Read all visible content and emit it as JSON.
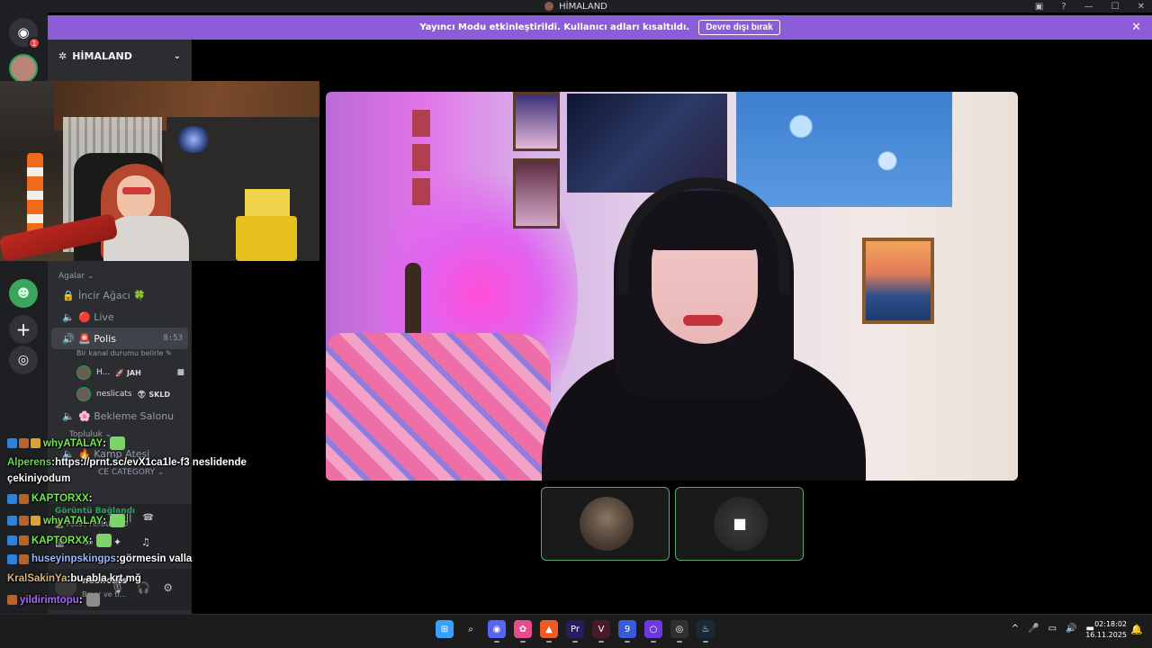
{
  "window": {
    "title": "HİMALAND",
    "controls": [
      "—",
      "☐",
      "✕"
    ]
  },
  "banner": {
    "message": "Yayıncı Modu etkinleştirildi. Kullanıcı adları kısaltıldı.",
    "button": "Devre dışı bırak",
    "close": "✕"
  },
  "rail": {
    "home_badge": "1"
  },
  "server": {
    "name": "HİMALAND"
  },
  "channels": {
    "category": "Agalar ⌄",
    "items": [
      {
        "name": "İncir Ağacı 🍀",
        "icon": "lock-icon"
      },
      {
        "name": "🔴 Live",
        "icon": "speaker-icon"
      },
      {
        "name": "🚨 Polis",
        "icon": "speaker-icon",
        "time": "8:53"
      },
      {
        "name": "🌸 Bekleme Salonu",
        "icon": "speaker-icon"
      }
    ],
    "status_placeholder": "Bir kanal durumu belirle ✎",
    "members": [
      {
        "name": "H...",
        "tag": "🚀 JAH"
      },
      {
        "name": "neslicats",
        "tag": "👽 SKLD"
      }
    ],
    "second_category": "Topluluk ⌄",
    "campfire": "🔥 Kamp Ateşi",
    "third_category": "CE CATEGORY ⌄"
  },
  "voice_panel": {
    "status": "Görüntü Bağlandı",
    "location": "🚨 Polis / HİMALAND"
  },
  "user_panel": {
    "name": "neslicats",
    "sub": "Bmor ve tl..."
  },
  "chat": [
    {
      "user": "whyATALAY",
      "sep": " :",
      "text": "",
      "badges": [
        "prime",
        "gift",
        "crown"
      ],
      "color": "green",
      "emote": "green"
    },
    {
      "user": "Alperens",
      "sep": " :",
      "text": " https://prnt.sc/evX1ca1le-f3 neslidende",
      "badges": [],
      "color": "lime"
    },
    {
      "user": "",
      "sep": "",
      "text": "çekiniyodum",
      "badges": [],
      "color": "white"
    },
    {
      "user": "KAPTORXX",
      "sep": " :",
      "text": "",
      "badges": [
        "prime",
        "gift"
      ],
      "color": "green"
    },
    {
      "user": "whyATALAY",
      "sep": " :",
      "text": "",
      "badges": [
        "prime",
        "gift",
        "crown"
      ],
      "color": "green",
      "emote": "green"
    },
    {
      "user": "KAPTORXX",
      "sep": " :",
      "text": "",
      "badges": [
        "prime",
        "gift"
      ],
      "color": "green",
      "emote": "green"
    },
    {
      "user": "huseyinpskingps",
      "sep": " :",
      "text": " görmesin valla",
      "badges": [
        "prime",
        "gift"
      ],
      "color": "blue"
    },
    {
      "user": "KralSakinYa",
      "sep": " :",
      "text": " bu abla krt mğ",
      "badges": [],
      "color": "tan"
    },
    {
      "user": "yildirimtopu",
      "sep": " :",
      "text": "",
      "badges": [
        "gift"
      ],
      "color": "purple",
      "emote": "gray"
    },
    {
      "user": "KAPTORXX",
      "sep": " :",
      "text": "",
      "badges": [
        "prime",
        "gift"
      ],
      "color": "green",
      "emote": "green"
    }
  ],
  "taskbar": {
    "apps": [
      {
        "name": "start-button",
        "glyph": "⊞",
        "color": "#3aa0ff"
      },
      {
        "name": "search-button",
        "glyph": "⌕",
        "color": "#1c1c1c"
      },
      {
        "name": "discord-app",
        "glyph": "◉",
        "color": "#5865f2"
      },
      {
        "name": "photos-app",
        "glyph": "✿",
        "color": "#e84c8a"
      },
      {
        "name": "brave-app",
        "glyph": "▲",
        "color": "#f25a24"
      },
      {
        "name": "premiere-app",
        "glyph": "Pr",
        "color": "#2a1a5e"
      },
      {
        "name": "obs-like-app",
        "glyph": "V",
        "color": "#4a1a2a"
      },
      {
        "name": "app-blue",
        "glyph": "9",
        "color": "#3a5ad8"
      },
      {
        "name": "app-circle",
        "glyph": "○",
        "color": "#6a3ae0"
      },
      {
        "name": "obs-app",
        "glyph": "◎",
        "color": "#303030"
      },
      {
        "name": "steam-app",
        "glyph": "♨",
        "color": "#1b2838"
      }
    ],
    "tray": [
      "^",
      "🎤",
      "▭",
      "🔊",
      "▬"
    ],
    "time": "02:18:02",
    "date": "16.11.2025"
  },
  "colors": {
    "banner": "#8d5cd8",
    "sidebar": "#2b2d31",
    "rail": "#1e1f22",
    "voice_green": "#23a55a",
    "tile_border": "#5aa66a"
  }
}
